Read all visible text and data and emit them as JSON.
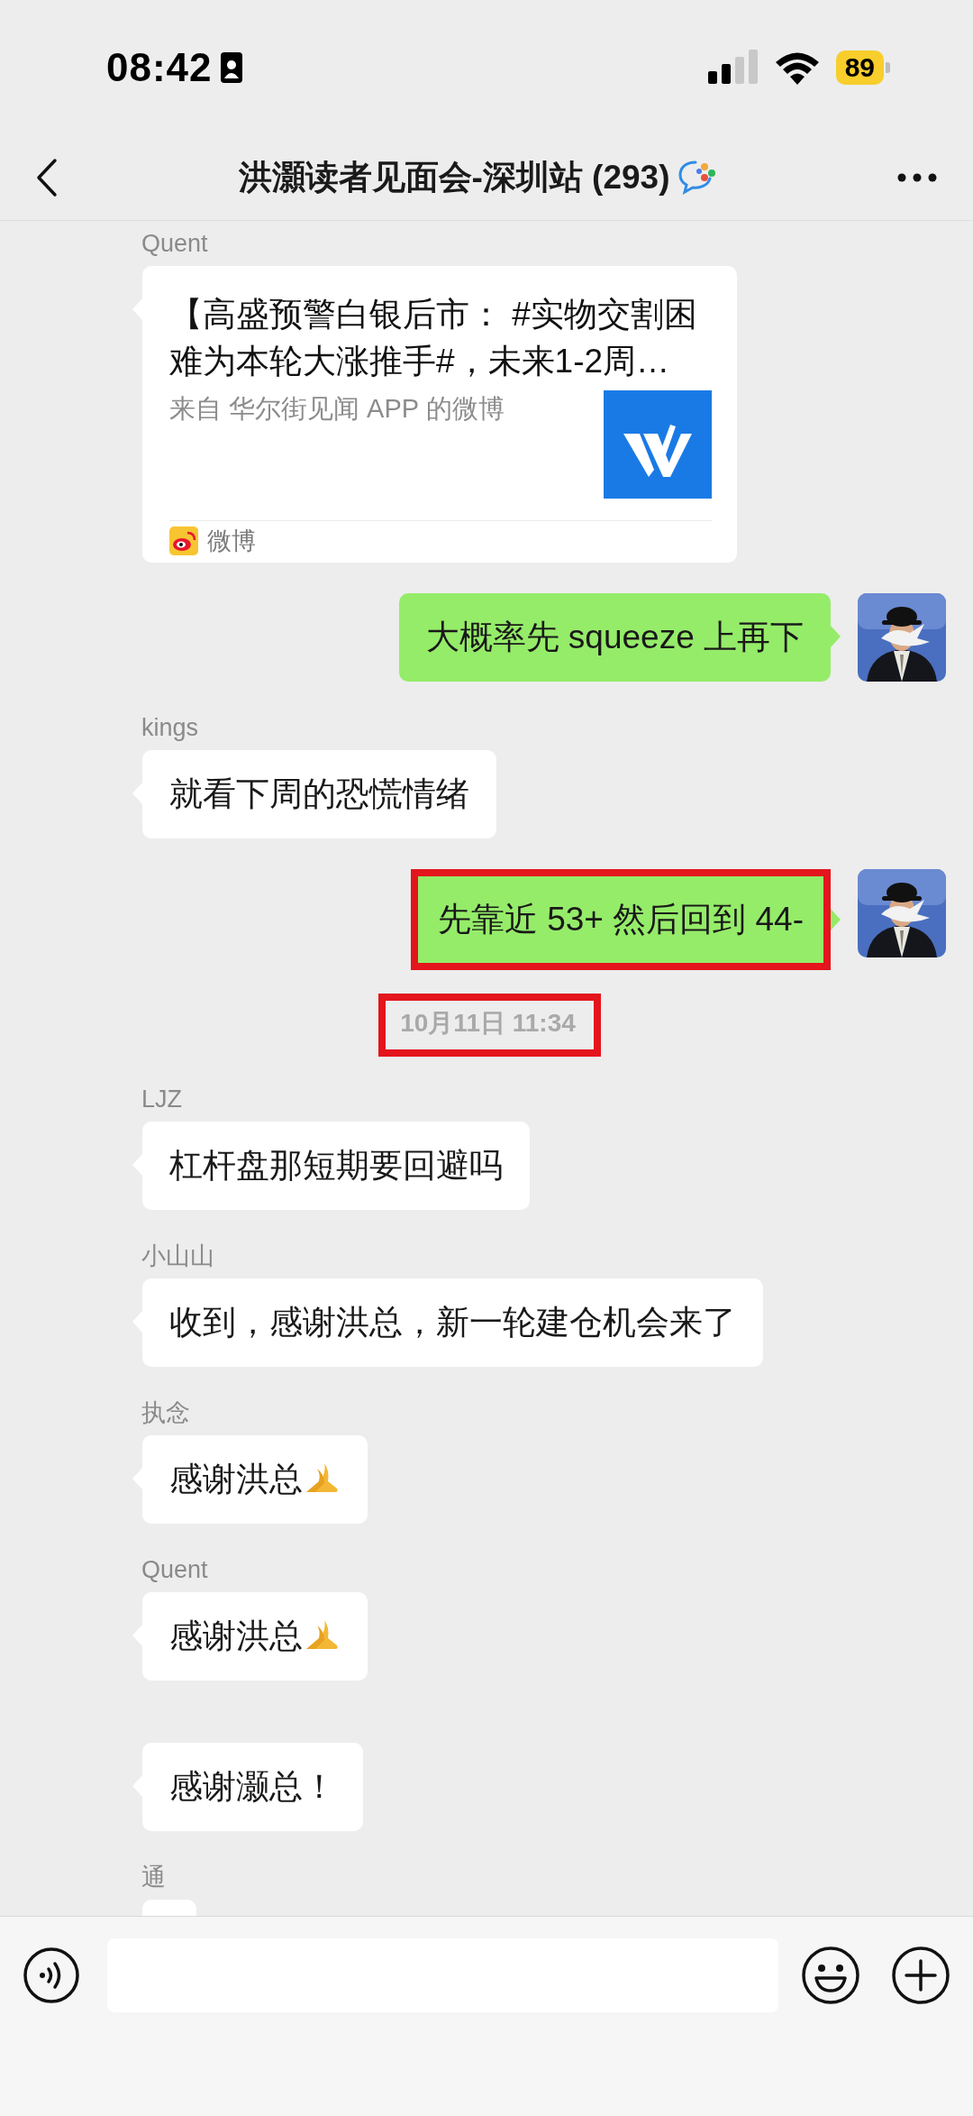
{
  "status_bar": {
    "time": "08:42",
    "battery": "89"
  },
  "header": {
    "title": "洪灝读者见面会-深圳站 (293)"
  },
  "messages": [
    {
      "kind": "card",
      "sender": "Quent",
      "title": "【高盛预警白银后市： #实物交割困难为本轮大涨推手#，未来1-2周…",
      "source": "来自 华尔街见闻 APP 的微博",
      "app": "微博"
    },
    {
      "kind": "outgoing",
      "text": "大概率先 squeeze 上再下"
    },
    {
      "kind": "incoming",
      "sender": "kings",
      "text": "就看下周的恐慌情绪"
    },
    {
      "kind": "outgoing",
      "text": "先靠近 53+ 然后回到 44-",
      "highlighted": true
    },
    {
      "kind": "time",
      "text": "10月11日 11:34",
      "highlighted": true
    },
    {
      "kind": "incoming",
      "sender": "LJZ",
      "text": "杠杆盘那短期要回避吗"
    },
    {
      "kind": "incoming",
      "sender": "小山山",
      "text": "收到，感谢洪总，新一轮建仓机会来了"
    },
    {
      "kind": "incoming",
      "sender": "执念",
      "text": "感谢洪总",
      "emoji": true
    },
    {
      "kind": "incoming",
      "sender": "Quent",
      "text": "感谢洪总",
      "emoji": true
    },
    {
      "kind": "incoming",
      "text": "感谢灏总！"
    },
    {
      "kind": "incoming",
      "sender": "通"
    }
  ]
}
